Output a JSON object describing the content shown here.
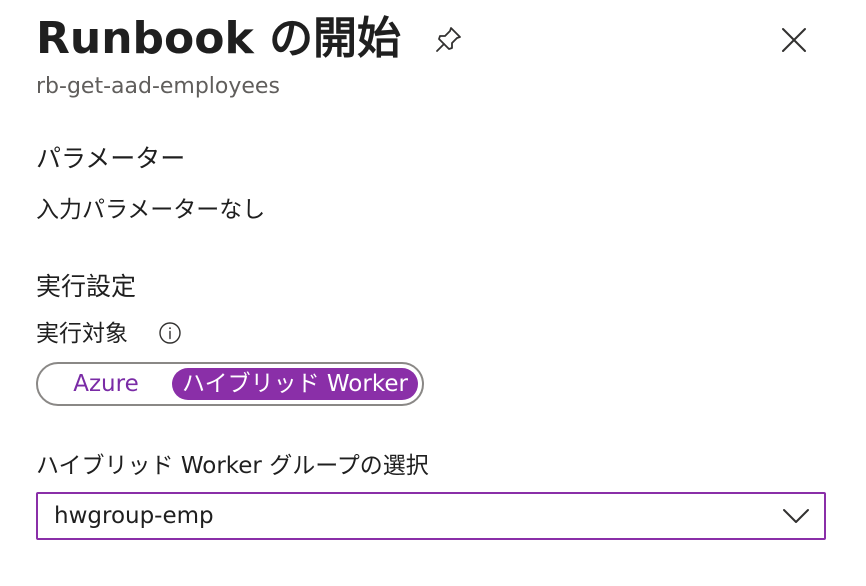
{
  "header": {
    "title": "Runbook の開始",
    "subtitle": "rb-get-aad-employees",
    "icons": {
      "pin": "pin-icon",
      "close": "close-icon"
    }
  },
  "parameters": {
    "heading": "パラメーター",
    "empty_text": "入力パラメーターなし"
  },
  "run_settings": {
    "heading": "実行設定",
    "run_on_label": "実行対象",
    "info_icon": "info-icon",
    "toggle": {
      "options": [
        "Azure",
        "ハイブリッド Worker"
      ],
      "selected": "ハイブリッド Worker"
    },
    "worker_group": {
      "label": "ハイブリッド Worker グループの選択",
      "value": "hwgroup-emp",
      "icon": "chevron-down-icon"
    }
  },
  "colors": {
    "accent": "#8a2fa8",
    "text": "#1f1f1f",
    "secondary_text": "#605e5c",
    "border": "#8a8886"
  }
}
